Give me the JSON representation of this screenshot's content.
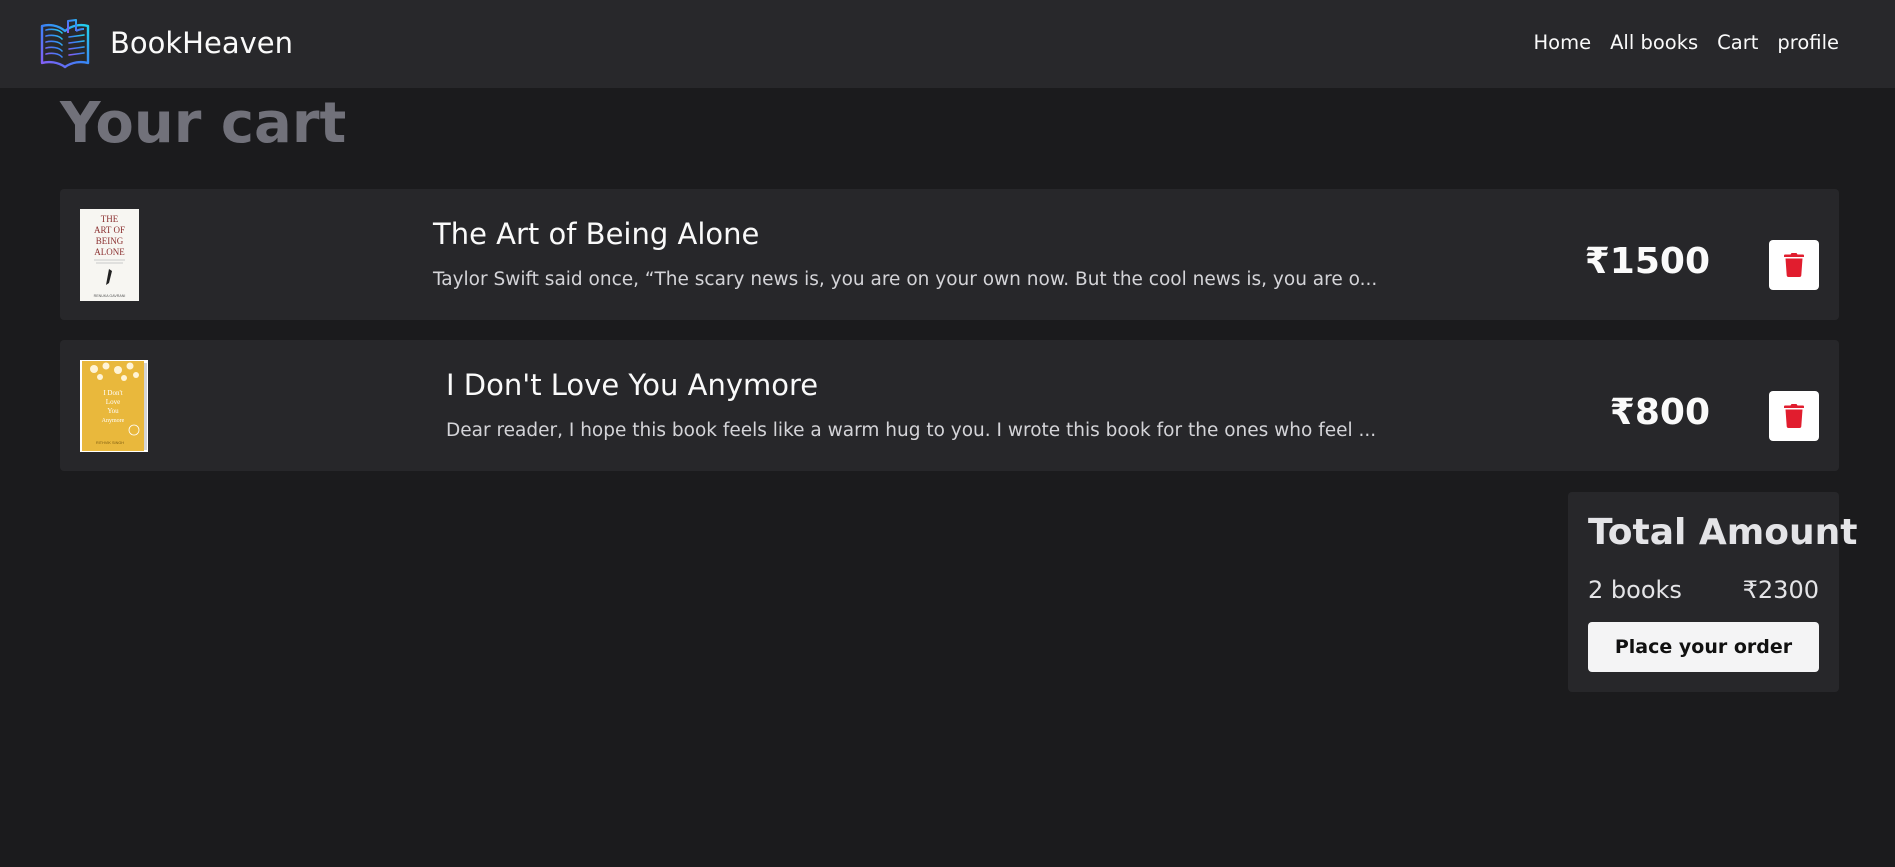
{
  "app": {
    "brand_name": "BookHeaven"
  },
  "nav": {
    "links": [
      "Home",
      "All books",
      "Cart",
      "profile"
    ]
  },
  "page": {
    "title": "Your cart"
  },
  "cart": {
    "items": [
      {
        "title": "The Art of Being Alone",
        "description": "Taylor Swift said once, “The scary news is, you are on your own now. But the cool news is, you are o...",
        "price": "₹1500",
        "cover": {
          "title_lines": [
            "THE",
            "ART OF",
            "BEING",
            "ALONE"
          ],
          "author": "RENUKA GAVRANI"
        }
      },
      {
        "title": "I Don't Love You Anymore",
        "description": "Dear reader, I hope this book feels like a warm hug to you. I wrote this book for the ones who feel ...",
        "price": "₹800",
        "cover": {
          "title_lines": [
            "I Don't",
            "Love",
            "You",
            "Anymore"
          ],
          "author": "RITHVIK SINGH"
        }
      }
    ]
  },
  "summary": {
    "title": "Total Amount",
    "count_text": "2 books",
    "total_text": "₹2300",
    "order_button_label": "Place your order"
  },
  "colors": {
    "background": "#1b1b1d",
    "card": "#27272a",
    "navbar": "#28282b",
    "delete_icon": "#e11d2e",
    "title_muted": "#71717a",
    "logo_gradient": [
      "#8b5cf6",
      "#3b82f6",
      "#22d3ee"
    ]
  },
  "icons": {
    "delete": "trash-icon",
    "logo": "open-book-icon"
  }
}
